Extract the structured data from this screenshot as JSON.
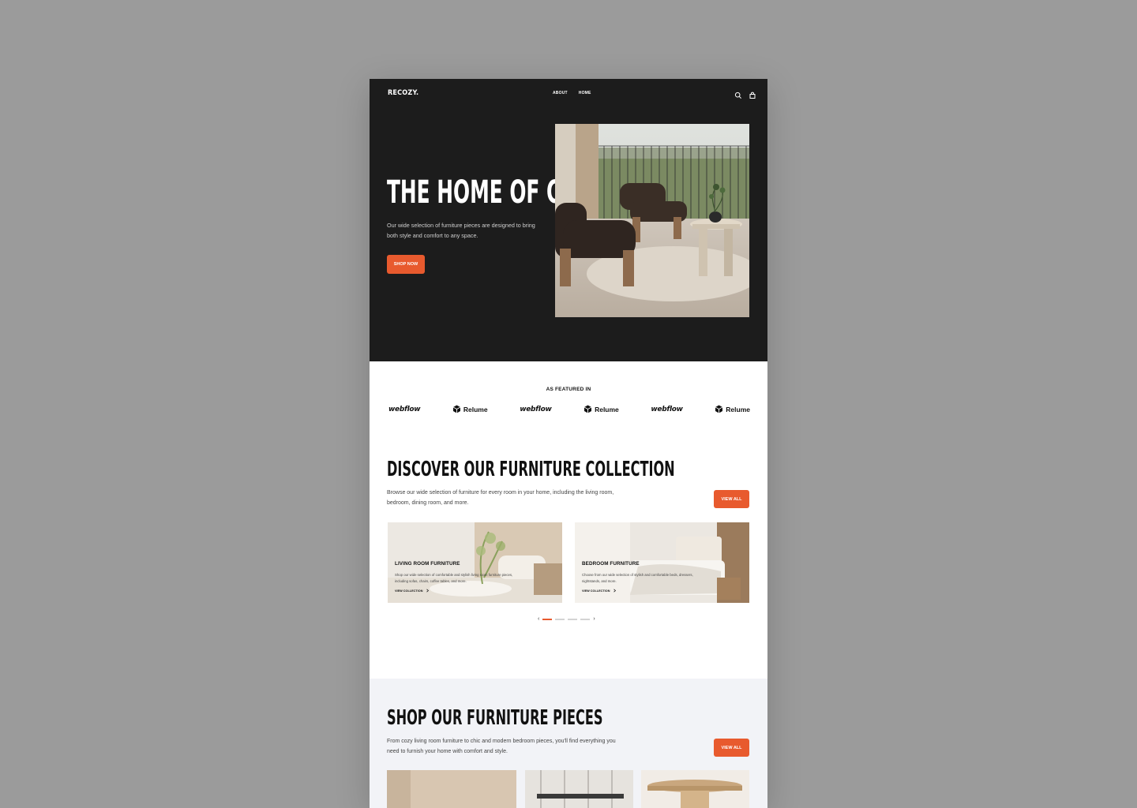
{
  "nav": {
    "logo": "RECOZY.",
    "links": [
      "ABOUT",
      "HOME"
    ],
    "icons": [
      "search-icon",
      "cart-icon"
    ]
  },
  "hero": {
    "title": "THE HOME OF COZY",
    "description": "Our wide selection of furniture pieces are designed to bring both style and comfort to any space.",
    "cta": "SHOP NOW"
  },
  "featured": {
    "label": "AS FEATURED IN",
    "logos": [
      "webflow",
      "Relume",
      "webflow",
      "Relume",
      "webflow",
      "Relume"
    ]
  },
  "collection": {
    "title": "DISCOVER OUR FURNITURE COLLECTION",
    "description": "Browse our wide selection of furniture for every room in your home, including the living room, bedroom, dining room, and more.",
    "view_all": "VIEW ALL",
    "cards": [
      {
        "title": "LIVING ROOM FURNITURE",
        "description": "Shop our wide selection of comfortable and stylish living room furniture pieces, including sofas, chairs, coffee tables, and more.",
        "link": "VIEW COLLECTION"
      },
      {
        "title": "BEDROOM FURNITURE",
        "description": "Choose from our wide selection of stylish and comfortable beds, dressers, nightstands, and more.",
        "link": "VIEW COLLECTION"
      }
    ],
    "pager": {
      "pages": 4,
      "active": 1
    }
  },
  "shop": {
    "title": "SHOP OUR FURNITURE PIECES",
    "description": "From cozy living room furniture to chic and modern bedroom pieces, you'll find everything you need to furnish your home with comfort and style.",
    "view_all": "VIEW ALL"
  },
  "colors": {
    "accent": "#e85a2e",
    "hero_bg": "#1c1c1c",
    "shop_bg": "#f2f3f7",
    "backdrop": "#9b9b9b"
  }
}
